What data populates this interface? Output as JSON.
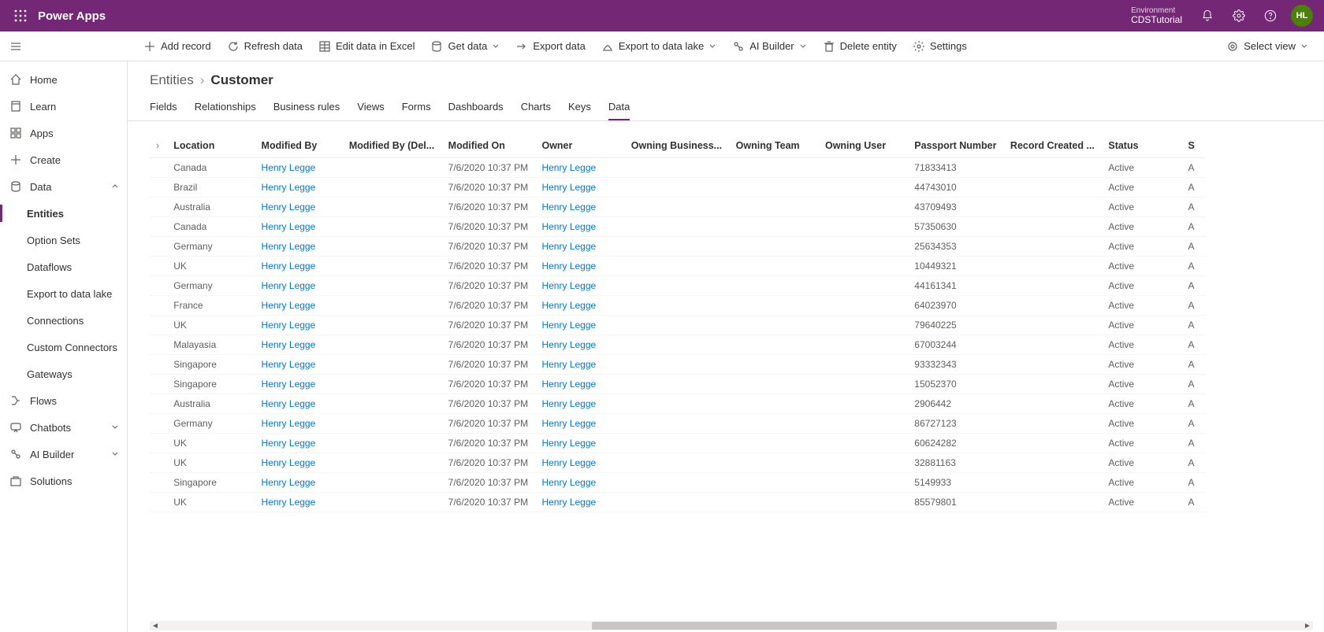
{
  "app_title": "Power Apps",
  "environment": {
    "label": "Environment",
    "name": "CDSTutorial"
  },
  "avatar_initials": "HL",
  "command_bar": {
    "add_record": "Add record",
    "refresh_data": "Refresh data",
    "edit_excel": "Edit data in Excel",
    "get_data": "Get data",
    "export_data": "Export data",
    "export_lake": "Export to data lake",
    "ai_builder": "AI Builder",
    "delete_entity": "Delete entity",
    "settings": "Settings",
    "select_view": "Select view"
  },
  "sidebar": {
    "home": "Home",
    "learn": "Learn",
    "apps": "Apps",
    "create": "Create",
    "data": "Data",
    "entities": "Entities",
    "option_sets": "Option Sets",
    "dataflows": "Dataflows",
    "export_lake": "Export to data lake",
    "connections": "Connections",
    "custom_connectors": "Custom Connectors",
    "gateways": "Gateways",
    "flows": "Flows",
    "chatbots": "Chatbots",
    "ai_builder": "AI Builder",
    "solutions": "Solutions"
  },
  "breadcrumb": {
    "root": "Entities",
    "leaf": "Customer"
  },
  "tabs": {
    "fields": "Fields",
    "relationships": "Relationships",
    "business_rules": "Business rules",
    "views": "Views",
    "forms": "Forms",
    "dashboards": "Dashboards",
    "charts": "Charts",
    "keys": "Keys",
    "data": "Data"
  },
  "columns": {
    "location": "Location",
    "modified_by": "Modified By",
    "modified_by_del": "Modified By (Del...",
    "modified_on": "Modified On",
    "owner": "Owner",
    "owning_business": "Owning Business...",
    "owning_team": "Owning Team",
    "owning_user": "Owning User",
    "passport": "Passport Number",
    "record_created": "Record Created ...",
    "status": "Status",
    "s_trunc": "S"
  },
  "row_defaults": {
    "modified_by": "Henry Legge",
    "modified_on": "7/6/2020 10:37 PM",
    "owner": "Henry Legge",
    "status": "Active",
    "s_trunc": "A"
  },
  "rows": [
    {
      "location": "Canada",
      "passport": "71833413"
    },
    {
      "location": "Brazil",
      "passport": "44743010"
    },
    {
      "location": "Australia",
      "passport": "43709493"
    },
    {
      "location": "Canada",
      "passport": "57350630"
    },
    {
      "location": "Germany",
      "passport": "25634353"
    },
    {
      "location": "UK",
      "passport": "10449321"
    },
    {
      "location": "Germany",
      "passport": "44161341"
    },
    {
      "location": "France",
      "passport": "64023970"
    },
    {
      "location": "UK",
      "passport": "79640225"
    },
    {
      "location": "Malayasia",
      "passport": "67003244"
    },
    {
      "location": "Singapore",
      "passport": "93332343"
    },
    {
      "location": "Singapore",
      "passport": "15052370"
    },
    {
      "location": "Australia",
      "passport": "2906442"
    },
    {
      "location": "Germany",
      "passport": "86727123"
    },
    {
      "location": "UK",
      "passport": "60624282"
    },
    {
      "location": "UK",
      "passport": "32881163"
    },
    {
      "location": "Singapore",
      "passport": "5149933"
    },
    {
      "location": "UK",
      "passport": "85579801"
    }
  ]
}
